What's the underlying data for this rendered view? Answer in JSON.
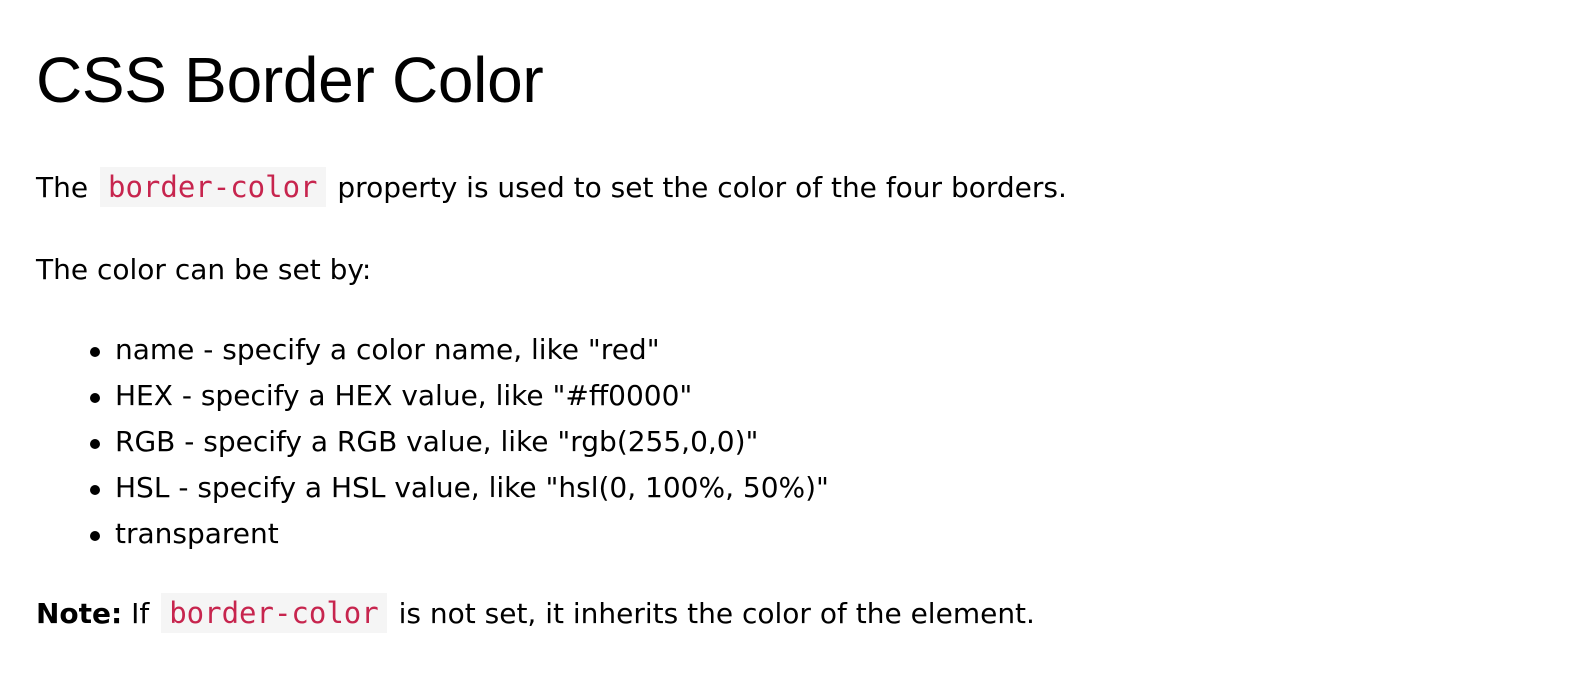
{
  "heading": "CSS Border Color",
  "intro": {
    "before": "The",
    "code": "border-color",
    "after": "property is used to set the color of the four borders."
  },
  "lead": "The color can be set by:",
  "list": [
    "name - specify a color name, like \"red\"",
    "HEX - specify a HEX value, like \"#ff0000\"",
    "RGB - specify a RGB value, like \"rgb(255,0,0)\"",
    "HSL - specify a HSL value, like \"hsl(0, 100%, 50%)\"",
    "transparent"
  ],
  "note": {
    "label": "Note:",
    "before": "If",
    "code": "border-color",
    "after": "is not set, it inherits the color of the element."
  },
  "colors": {
    "code_text": "#c7254e",
    "code_background": "#f5f5f5",
    "text": "#000000",
    "background": "#ffffff"
  }
}
